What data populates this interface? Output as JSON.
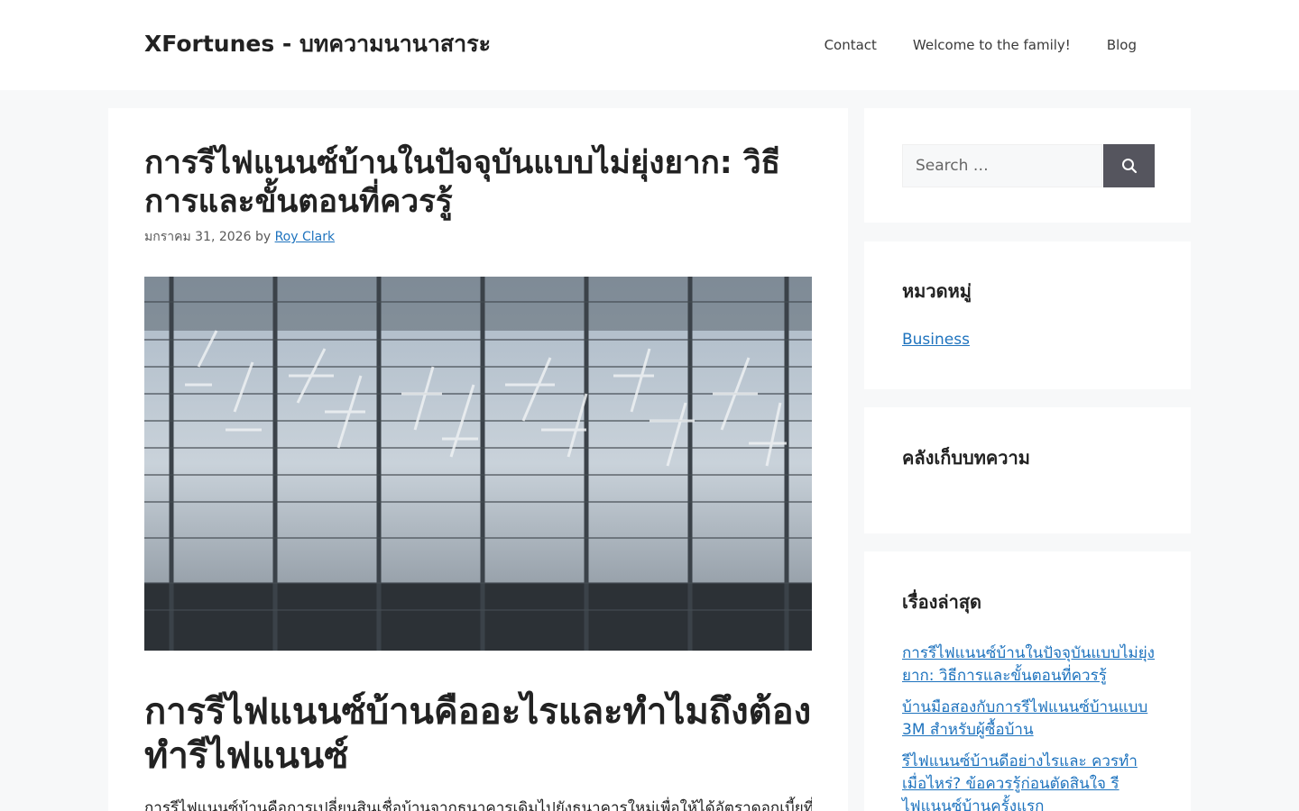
{
  "header": {
    "site_title": "XFortunes - บทความนานาสาระ",
    "nav": [
      "Contact",
      "Welcome to the family!",
      "Blog"
    ]
  },
  "article": {
    "title": "การรีไฟแนนซ์บ้านในปัจจุบันแบบไม่ยุ่งยาก: วิธีการและขั้นตอนที่ควรรู้",
    "date": "มกราคม 31, 2026",
    "by": "by",
    "author": "Roy Clark",
    "image_alt": "ภาพอาคารกระจก",
    "heading": "การรีไฟแนนซ์บ้านคืออะไรและทำไมถึงต้องทำรีไฟแนนซ์",
    "body_text": "การรีไฟแนนซ์บ้านคือการเปลี่ยนสินเชื่อบ้านจากธนาคารเดิมไปยังธนาคารใหม่เพื่อให้ได้อัตราดอกเบี้ยที่ดีกว่า เพื่อลดภาระการผ่อน"
  },
  "sidebar": {
    "search_placeholder": "Search …",
    "search_button_icon": "search-icon",
    "categories_title": "หมวดหมู่",
    "categories": [
      "Business"
    ],
    "archives_title": "คลังเก็บบทความ",
    "recent_title": "เรื่องล่าสุด",
    "recent_posts": [
      "การรีไฟแนนซ์บ้านในปัจจุบันแบบไม่ยุ่งยาก: วิธีการและขั้นตอนที่ควรรู้",
      "บ้านมือสองกับการรีไฟแนนซ์บ้านแบบ 3M สำหรับผู้ซื้อบ้าน",
      "รีไฟแนนซ์บ้านดีอย่างไรและ ควรทำเมื่อไหร่? ข้อควรรู้ก่อนตัดสินใจ รีไฟแนนซ์บ้านครั้งแรก"
    ]
  },
  "colors": {
    "link": "#1e73be",
    "search_button": "#55555e",
    "page_background": "#f7f8f9"
  }
}
